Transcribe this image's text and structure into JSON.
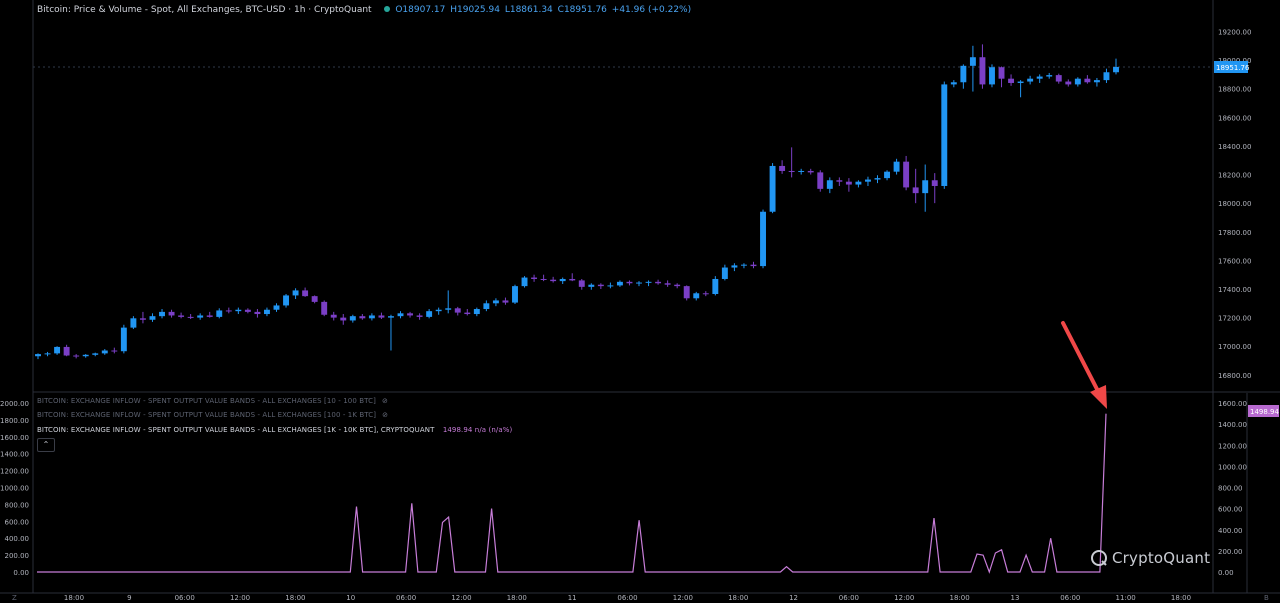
{
  "header": {
    "title": "Bitcoin: Price & Volume - Spot, All Exchanges, BTC-USD · 1h · CryptoQuant",
    "ohlc": {
      "o": "O18907.17",
      "h": "H19025.94",
      "l": "L18861.34",
      "c": "C18951.76",
      "chg": "+41.96 (+0.22%)"
    }
  },
  "indicators": [
    {
      "label": "BITCOIN: EXCHANGE INFLOW - SPENT OUTPUT VALUE BANDS - ALL EXCHANGES [10 - 100 BTC]",
      "state": "hidden"
    },
    {
      "label": "BITCOIN: EXCHANGE INFLOW - SPENT OUTPUT VALUE BANDS - ALL EXCHANGES [100 - 1K BTC]",
      "state": "hidden"
    },
    {
      "label": "BITCOIN: EXCHANGE INFLOW - SPENT OUTPUT VALUE BANDS - ALL EXCHANGES [1K - 10K BTC], CRYPTOQUANT",
      "value": "1498.94",
      "extra": "n/a (n/a%)"
    }
  ],
  "collapse_label": "⌃",
  "logo_text": "CryptoQuant",
  "corner_left_top": "Z",
  "corner_right_bottom": "B",
  "colors": {
    "up": "#2196f3",
    "down": "#7b3fc6",
    "inflow": "#c77dd8",
    "last_price_bg": "#2196f3",
    "last_inflow_bg": "#b86ad0",
    "arrow": "#f04848"
  },
  "chart_data": [
    {
      "type": "candlestick",
      "title": "Bitcoin: Price & Volume - Spot, All Exchanges, BTC-USD · 1h · CryptoQuant",
      "yaxis_ticks": [
        16800,
        17000,
        17200,
        17400,
        17600,
        17800,
        18000,
        18200,
        18400,
        18600,
        18800,
        19000,
        19200
      ],
      "ylim": [
        16680,
        19420
      ],
      "last_price": 18951.76,
      "last_price_label": "18951.76",
      "candles": [
        [
          16930,
          16950,
          16910,
          16945
        ],
        [
          16945,
          16960,
          16930,
          16950
        ],
        [
          16950,
          17000,
          16940,
          16995
        ],
        [
          16995,
          17010,
          16930,
          16935
        ],
        [
          16935,
          16945,
          16915,
          16930
        ],
        [
          16930,
          16945,
          16920,
          16940
        ],
        [
          16940,
          16955,
          16930,
          16950
        ],
        [
          16950,
          16980,
          16940,
          16970
        ],
        [
          16970,
          16990,
          16950,
          16965
        ],
        [
          16965,
          17150,
          16950,
          17130
        ],
        [
          17130,
          17210,
          17120,
          17195
        ],
        [
          17195,
          17240,
          17160,
          17185
        ],
        [
          17185,
          17230,
          17170,
          17210
        ],
        [
          17210,
          17260,
          17195,
          17240
        ],
        [
          17240,
          17255,
          17200,
          17215
        ],
        [
          17215,
          17235,
          17195,
          17205
        ],
        [
          17205,
          17225,
          17190,
          17200
        ],
        [
          17200,
          17230,
          17185,
          17215
        ],
        [
          17215,
          17240,
          17200,
          17205
        ],
        [
          17205,
          17265,
          17195,
          17250
        ],
        [
          17250,
          17270,
          17230,
          17245
        ],
        [
          17245,
          17270,
          17225,
          17255
        ],
        [
          17255,
          17265,
          17230,
          17240
        ],
        [
          17240,
          17260,
          17200,
          17225
        ],
        [
          17225,
          17270,
          17210,
          17255
        ],
        [
          17255,
          17300,
          17240,
          17285
        ],
        [
          17285,
          17365,
          17270,
          17355
        ],
        [
          17355,
          17405,
          17330,
          17390
        ],
        [
          17390,
          17410,
          17345,
          17350
        ],
        [
          17350,
          17355,
          17300,
          17310
        ],
        [
          17310,
          17320,
          17210,
          17220
        ],
        [
          17220,
          17240,
          17180,
          17200
        ],
        [
          17200,
          17225,
          17150,
          17180
        ],
        [
          17180,
          17220,
          17165,
          17210
        ],
        [
          17210,
          17225,
          17185,
          17195
        ],
        [
          17195,
          17230,
          17180,
          17215
        ],
        [
          17215,
          17235,
          17190,
          17200
        ],
        [
          17200,
          17220,
          16970,
          17210
        ],
        [
          17210,
          17245,
          17195,
          17230
        ],
        [
          17230,
          17240,
          17200,
          17215
        ],
        [
          17215,
          17230,
          17185,
          17205
        ],
        [
          17205,
          17260,
          17195,
          17245
        ],
        [
          17245,
          17270,
          17220,
          17255
        ],
        [
          17255,
          17390,
          17230,
          17265
        ],
        [
          17265,
          17275,
          17215,
          17235
        ],
        [
          17235,
          17260,
          17215,
          17225
        ],
        [
          17225,
          17270,
          17210,
          17260
        ],
        [
          17260,
          17320,
          17245,
          17300
        ],
        [
          17300,
          17335,
          17280,
          17320
        ],
        [
          17320,
          17340,
          17290,
          17305
        ],
        [
          17305,
          17430,
          17295,
          17420
        ],
        [
          17420,
          17490,
          17410,
          17480
        ],
        [
          17480,
          17500,
          17450,
          17470
        ],
        [
          17470,
          17500,
          17455,
          17465
        ],
        [
          17465,
          17485,
          17445,
          17455
        ],
        [
          17455,
          17480,
          17435,
          17470
        ],
        [
          17470,
          17510,
          17455,
          17460
        ],
        [
          17460,
          17470,
          17395,
          17415
        ],
        [
          17415,
          17440,
          17395,
          17430
        ],
        [
          17430,
          17440,
          17400,
          17420
        ],
        [
          17420,
          17445,
          17405,
          17425
        ],
        [
          17425,
          17460,
          17415,
          17450
        ],
        [
          17450,
          17460,
          17425,
          17440
        ],
        [
          17440,
          17455,
          17420,
          17445
        ],
        [
          17445,
          17460,
          17420,
          17450
        ],
        [
          17450,
          17465,
          17430,
          17440
        ],
        [
          17440,
          17460,
          17415,
          17430
        ],
        [
          17430,
          17440,
          17405,
          17420
        ],
        [
          17420,
          17425,
          17320,
          17335
        ],
        [
          17335,
          17380,
          17320,
          17370
        ],
        [
          17370,
          17385,
          17350,
          17365
        ],
        [
          17365,
          17490,
          17355,
          17470
        ],
        [
          17470,
          17570,
          17460,
          17550
        ],
        [
          17550,
          17580,
          17525,
          17565
        ],
        [
          17565,
          17580,
          17545,
          17570
        ],
        [
          17570,
          17590,
          17545,
          17560
        ],
        [
          17560,
          17955,
          17545,
          17940
        ],
        [
          17940,
          18280,
          17930,
          18260
        ],
        [
          18260,
          18300,
          18205,
          18225
        ],
        [
          18225,
          18390,
          18180,
          18220
        ],
        [
          18220,
          18240,
          18200,
          18225
        ],
        [
          18225,
          18240,
          18200,
          18215
        ],
        [
          18215,
          18230,
          18080,
          18100
        ],
        [
          18100,
          18180,
          18070,
          18160
        ],
        [
          18160,
          18180,
          18120,
          18150
        ],
        [
          18150,
          18175,
          18080,
          18130
        ],
        [
          18130,
          18160,
          18110,
          18150
        ],
        [
          18150,
          18185,
          18120,
          18165
        ],
        [
          18165,
          18195,
          18140,
          18175
        ],
        [
          18175,
          18230,
          18160,
          18220
        ],
        [
          18220,
          18310,
          18200,
          18290
        ],
        [
          18290,
          18330,
          18090,
          18110
        ],
        [
          18110,
          18240,
          18000,
          18070
        ],
        [
          18070,
          18270,
          17940,
          18160
        ],
        [
          18160,
          18210,
          18000,
          18120
        ],
        [
          18120,
          18850,
          18100,
          18830
        ],
        [
          18830,
          18860,
          18810,
          18845
        ],
        [
          18845,
          18970,
          18800,
          18960
        ],
        [
          18960,
          19100,
          18780,
          19020
        ],
        [
          19020,
          19110,
          18800,
          18830
        ],
        [
          18830,
          18970,
          18810,
          18950
        ],
        [
          18950,
          18955,
          18810,
          18870
        ],
        [
          18870,
          18900,
          18820,
          18840
        ],
        [
          18840,
          18860,
          18740,
          18850
        ],
        [
          18850,
          18890,
          18830,
          18870
        ],
        [
          18870,
          18900,
          18840,
          18885
        ],
        [
          18885,
          18910,
          18870,
          18895
        ],
        [
          18895,
          18905,
          18835,
          18850
        ],
        [
          18850,
          18865,
          18815,
          18830
        ],
        [
          18830,
          18880,
          18815,
          18870
        ],
        [
          18870,
          18895,
          18835,
          18845
        ],
        [
          18845,
          18875,
          18815,
          18860
        ],
        [
          18860,
          18940,
          18840,
          18915
        ],
        [
          18915,
          19010,
          18900,
          18952
        ]
      ],
      "xaxis": {
        "ticks": [
          "18:00",
          "9",
          "06:00",
          "12:00",
          "18:00",
          "10",
          "06:00",
          "12:00",
          "18:00",
          "11",
          "06:00",
          "12:00",
          "18:00",
          "12",
          "06:00",
          "12:00",
          "18:00",
          "13",
          "06:00",
          "11:00",
          "18:00"
        ]
      }
    },
    {
      "type": "line",
      "series": [
        {
          "name": "BITCOIN: EXCHANGE INFLOW - SPENT OUTPUT VALUE BANDS - ALL EXCHANGES [1K - 10K BTC], CRYPTOQUANT",
          "values": [
            0,
            0,
            0,
            0,
            0,
            0,
            0,
            0,
            0,
            0,
            0,
            0,
            0,
            0,
            0,
            0,
            0,
            0,
            0,
            0,
            0,
            0,
            0,
            0,
            0,
            0,
            0,
            0,
            0,
            0,
            0,
            0,
            0,
            0,
            0,
            0,
            0,
            0,
            0,
            0,
            0,
            0,
            0,
            0,
            0,
            0,
            0,
            0,
            0,
            0,
            0,
            0,
            620,
            0,
            0,
            0,
            0,
            0,
            0,
            0,
            0,
            650,
            0,
            0,
            0,
            0,
            470,
            520,
            0,
            0,
            0,
            0,
            0,
            0,
            600,
            0,
            0,
            0,
            0,
            0,
            0,
            0,
            0,
            0,
            0,
            0,
            0,
            0,
            0,
            0,
            0,
            0,
            0,
            0,
            0,
            0,
            0,
            0,
            490,
            0,
            0,
            0,
            0,
            0,
            0,
            0,
            0,
            0,
            0,
            0,
            0,
            0,
            0,
            0,
            0,
            0,
            0,
            0,
            0,
            0,
            0,
            0,
            50,
            0,
            0,
            0,
            0,
            0,
            0,
            0,
            0,
            0,
            0,
            0,
            0,
            0,
            0,
            0,
            0,
            0,
            0,
            0,
            0,
            0,
            0,
            0,
            510,
            0,
            0,
            0,
            0,
            0,
            0,
            170,
            160,
            0,
            180,
            210,
            0,
            0,
            0,
            160,
            0,
            0,
            0,
            320,
            0,
            0,
            0,
            0,
            0,
            0,
            0,
            0,
            1498.94
          ]
        }
      ],
      "left_axis_ticks": [
        0,
        200,
        400,
        600,
        800,
        1000,
        1200,
        1400,
        1600,
        1800,
        2000
      ],
      "right_axis_ticks": [
        0,
        200,
        400,
        600,
        800,
        1000,
        1200,
        1400,
        1600
      ],
      "last_value_label": "1498.94"
    }
  ]
}
